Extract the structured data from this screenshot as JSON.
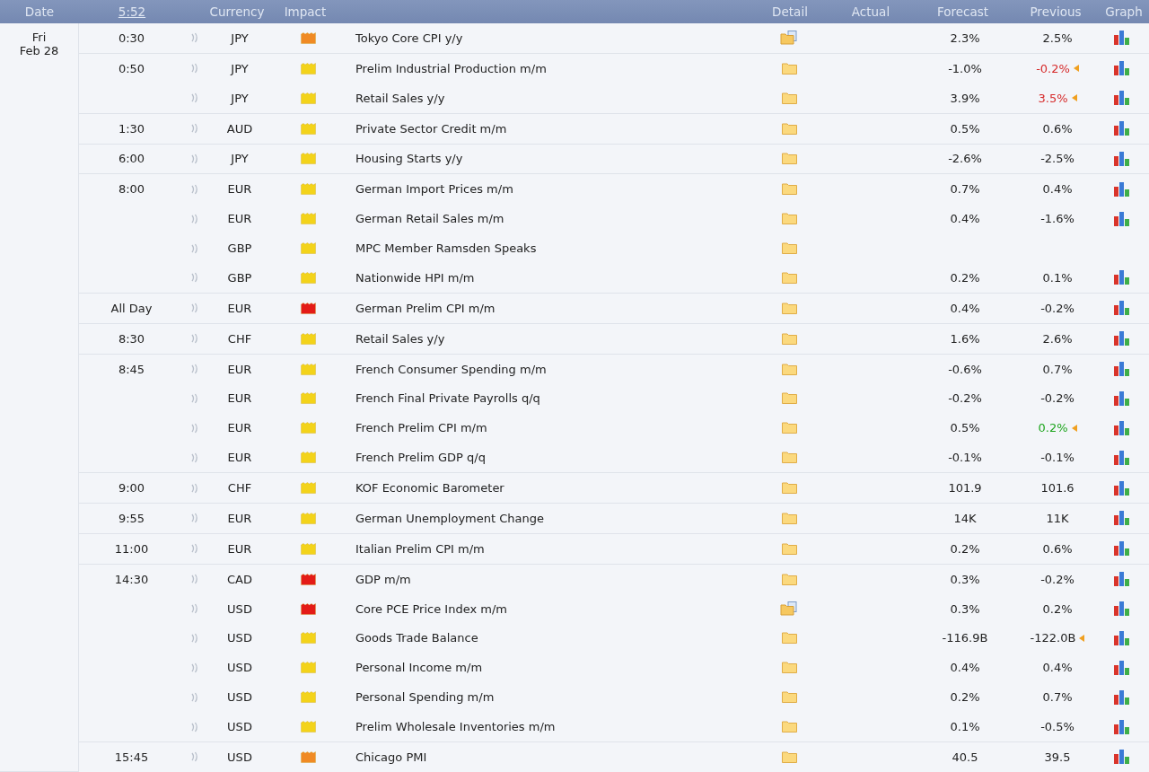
{
  "header": {
    "date": "Date",
    "time": "5:52",
    "currency": "Currency",
    "impact": "Impact",
    "detail": "Detail",
    "actual": "Actual",
    "forecast": "Forecast",
    "previous": "Previous",
    "graph": "Graph"
  },
  "day": {
    "weekday": "Fri",
    "date": "Feb 28"
  },
  "rows": [
    {
      "time": "0:30",
      "currency": "JPY",
      "color": "#f08a24",
      "event": "Tokyo Core CPI y/y",
      "has_document": true,
      "forecast": "2.3%",
      "previous": "2.5%",
      "previous_worse": false,
      "previous_better": false,
      "revised": false,
      "graph": true
    },
    {
      "time": "0:50",
      "currency": "JPY",
      "color": "#f3d31a",
      "event": "Prelim Industrial Production m/m",
      "has_document": false,
      "forecast": "-1.0%",
      "previous": "-0.2%",
      "previous_worse": true,
      "previous_better": false,
      "revised": true,
      "graph": true
    },
    {
      "currency": "JPY",
      "color": "#f3d31a",
      "event": "Retail Sales y/y",
      "has_document": false,
      "forecast": "3.9%",
      "previous": "3.5%",
      "previous_worse": true,
      "previous_better": false,
      "revised": true,
      "graph": true
    },
    {
      "time": "1:30",
      "currency": "AUD",
      "color": "#f3d31a",
      "event": "Private Sector Credit m/m",
      "has_document": false,
      "forecast": "0.5%",
      "previous": "0.6%",
      "previous_worse": false,
      "previous_better": false,
      "revised": false,
      "graph": true
    },
    {
      "time": "6:00",
      "currency": "JPY",
      "color": "#f3d31a",
      "event": "Housing Starts y/y",
      "has_document": false,
      "forecast": "-2.6%",
      "previous": "-2.5%",
      "previous_worse": false,
      "previous_better": false,
      "revised": false,
      "graph": true
    },
    {
      "time": "8:00",
      "currency": "EUR",
      "color": "#f3d31a",
      "event": "German Import Prices m/m",
      "has_document": false,
      "forecast": "0.7%",
      "previous": "0.4%",
      "previous_worse": false,
      "previous_better": false,
      "revised": false,
      "graph": true
    },
    {
      "currency": "EUR",
      "color": "#f3d31a",
      "event": "German Retail Sales m/m",
      "has_document": false,
      "forecast": "0.4%",
      "previous": "-1.6%",
      "previous_worse": false,
      "previous_better": false,
      "revised": false,
      "graph": true
    },
    {
      "currency": "GBP",
      "color": "#f3d31a",
      "event": "MPC Member Ramsden Speaks",
      "has_document": false,
      "revised": false,
      "graph": false
    },
    {
      "currency": "GBP",
      "color": "#f3d31a",
      "event": "Nationwide HPI m/m",
      "has_document": false,
      "forecast": "0.2%",
      "previous": "0.1%",
      "previous_worse": false,
      "previous_better": false,
      "revised": false,
      "graph": true
    },
    {
      "time": "All Day",
      "currency": "EUR",
      "color": "#e41b17",
      "event": "German Prelim CPI m/m",
      "has_document": false,
      "forecast": "0.4%",
      "previous": "-0.2%",
      "previous_worse": false,
      "previous_better": false,
      "revised": false,
      "graph": true
    },
    {
      "time": "8:30",
      "currency": "CHF",
      "color": "#f3d31a",
      "event": "Retail Sales y/y",
      "has_document": false,
      "forecast": "1.6%",
      "previous": "2.6%",
      "previous_worse": false,
      "previous_better": false,
      "revised": false,
      "graph": true
    },
    {
      "time": "8:45",
      "currency": "EUR",
      "color": "#f3d31a",
      "event": "French Consumer Spending m/m",
      "has_document": false,
      "forecast": "-0.6%",
      "previous": "0.7%",
      "previous_worse": false,
      "previous_better": false,
      "revised": false,
      "graph": true
    },
    {
      "currency": "EUR",
      "color": "#f3d31a",
      "event": "French Final Private Payrolls q/q",
      "has_document": false,
      "forecast": "-0.2%",
      "previous": "-0.2%",
      "previous_worse": false,
      "previous_better": false,
      "revised": false,
      "graph": true
    },
    {
      "currency": "EUR",
      "color": "#f3d31a",
      "event": "French Prelim CPI m/m",
      "has_document": false,
      "forecast": "0.5%",
      "previous": "0.2%",
      "previous_worse": false,
      "previous_better": true,
      "revised": true,
      "graph": true
    },
    {
      "currency": "EUR",
      "color": "#f3d31a",
      "event": "French Prelim GDP q/q",
      "has_document": false,
      "forecast": "-0.1%",
      "previous": "-0.1%",
      "previous_worse": false,
      "previous_better": false,
      "revised": false,
      "graph": true
    },
    {
      "time": "9:00",
      "currency": "CHF",
      "color": "#f3d31a",
      "event": "KOF Economic Barometer",
      "has_document": false,
      "forecast": "101.9",
      "previous": "101.6",
      "previous_worse": false,
      "previous_better": false,
      "revised": false,
      "graph": true
    },
    {
      "time": "9:55",
      "currency": "EUR",
      "color": "#f3d31a",
      "event": "German Unemployment Change",
      "has_document": false,
      "forecast": "14K",
      "previous": "11K",
      "previous_worse": false,
      "previous_better": false,
      "revised": false,
      "graph": true
    },
    {
      "time": "11:00",
      "currency": "EUR",
      "color": "#f3d31a",
      "event": "Italian Prelim CPI m/m",
      "has_document": false,
      "forecast": "0.2%",
      "previous": "0.6%",
      "previous_worse": false,
      "previous_better": false,
      "revised": false,
      "graph": true
    },
    {
      "time": "14:30",
      "currency": "CAD",
      "color": "#e41b17",
      "event": "GDP m/m",
      "has_document": false,
      "forecast": "0.3%",
      "previous": "-0.2%",
      "previous_worse": false,
      "previous_better": false,
      "revised": false,
      "graph": true
    },
    {
      "currency": "USD",
      "color": "#e41b17",
      "event": "Core PCE Price Index m/m",
      "has_document": true,
      "forecast": "0.3%",
      "previous": "0.2%",
      "previous_worse": false,
      "previous_better": false,
      "revised": false,
      "graph": true
    },
    {
      "currency": "USD",
      "color": "#f3d31a",
      "event": "Goods Trade Balance",
      "has_document": false,
      "forecast": "-116.9B",
      "previous": "-122.0B",
      "previous_worse": false,
      "previous_better": false,
      "revised": true,
      "graph": true
    },
    {
      "currency": "USD",
      "color": "#f3d31a",
      "event": "Personal Income m/m",
      "has_document": false,
      "forecast": "0.4%",
      "previous": "0.4%",
      "previous_worse": false,
      "previous_better": false,
      "revised": false,
      "graph": true
    },
    {
      "currency": "USD",
      "color": "#f3d31a",
      "event": "Personal Spending m/m",
      "has_document": false,
      "forecast": "0.2%",
      "previous": "0.7%",
      "previous_worse": false,
      "previous_better": false,
      "revised": false,
      "graph": true
    },
    {
      "currency": "USD",
      "color": "#f3d31a",
      "event": "Prelim Wholesale Inventories m/m",
      "has_document": false,
      "forecast": "0.1%",
      "previous": "-0.5%",
      "previous_worse": false,
      "previous_better": false,
      "revised": false,
      "graph": true
    },
    {
      "time": "15:45",
      "currency": "USD",
      "color": "#f08a24",
      "event": "Chicago PMI",
      "has_document": false,
      "forecast": "40.5",
      "previous": "39.5",
      "previous_worse": false,
      "previous_better": false,
      "revised": false,
      "graph": true
    }
  ]
}
